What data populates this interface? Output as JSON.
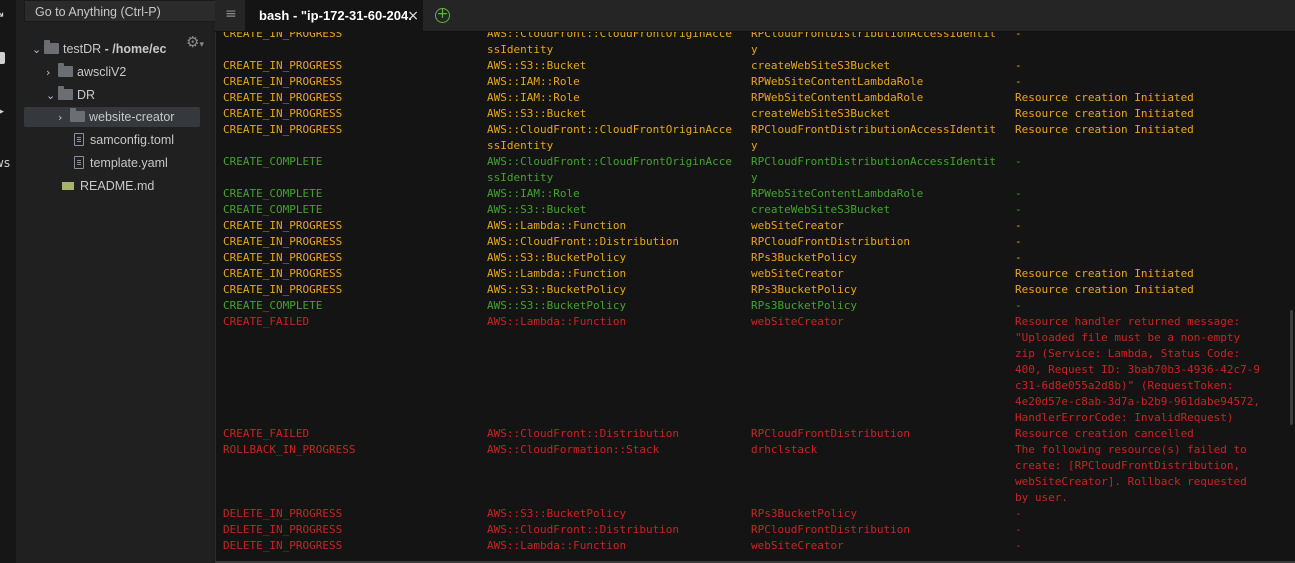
{
  "sidebar": {
    "goto_placeholder": "Go to Anything (Ctrl-P)",
    "tree": [
      {
        "name": "testDR",
        "suffix": " - /home/ec",
        "type": "folder",
        "expanded": true
      },
      {
        "name": "awscliV2",
        "type": "folder",
        "expanded": false
      },
      {
        "name": "DR",
        "type": "folder",
        "expanded": true
      },
      {
        "name": "website-creator",
        "type": "folder",
        "expanded": false,
        "selected": true
      },
      {
        "name": "samconfig.toml",
        "type": "file"
      },
      {
        "name": "template.yaml",
        "type": "file"
      },
      {
        "name": "README.md",
        "type": "markdown"
      }
    ]
  },
  "tabs": {
    "active_title": "bash - \"ip-172-31-60-204.",
    "close_icon": "×"
  },
  "colors": {
    "in_progress": "#e5a61e",
    "complete": "#43a32f",
    "failed": "#c72523",
    "add_tab": "#5fb832"
  },
  "terminal": {
    "rows": [
      {
        "color": "yellow",
        "status": "CREATE_IN_PROGRESS",
        "type": "AWS::CloudFront::CloudFrontOriginAcce\nssIdentity",
        "logical_id": "RPCloudFrontDistributionAccessIdentit\ny",
        "reason": "-"
      },
      {
        "color": "yellow",
        "status": "CREATE_IN_PROGRESS",
        "type": "AWS::S3::Bucket",
        "logical_id": "createWebSiteS3Bucket",
        "reason": "-"
      },
      {
        "color": "yellow",
        "status": "CREATE_IN_PROGRESS",
        "type": "AWS::IAM::Role",
        "logical_id": "RPWebSiteContentLambdaRole",
        "reason": "-"
      },
      {
        "color": "yellow",
        "status": "CREATE_IN_PROGRESS",
        "type": "AWS::IAM::Role",
        "logical_id": "RPWebSiteContentLambdaRole",
        "reason": "Resource creation Initiated"
      },
      {
        "color": "yellow",
        "status": "CREATE_IN_PROGRESS",
        "type": "AWS::S3::Bucket",
        "logical_id": "createWebSiteS3Bucket",
        "reason": "Resource creation Initiated"
      },
      {
        "color": "yellow",
        "status": "CREATE_IN_PROGRESS",
        "type": "AWS::CloudFront::CloudFrontOriginAcce\nssIdentity",
        "logical_id": "RPCloudFrontDistributionAccessIdentit\ny",
        "reason": "Resource creation Initiated"
      },
      {
        "color": "green",
        "status": "CREATE_COMPLETE",
        "type": "AWS::CloudFront::CloudFrontOriginAcce\nssIdentity",
        "logical_id": "RPCloudFrontDistributionAccessIdentit\ny",
        "reason": "-"
      },
      {
        "color": "green",
        "status": "CREATE_COMPLETE",
        "type": "AWS::IAM::Role",
        "logical_id": "RPWebSiteContentLambdaRole",
        "reason": "-"
      },
      {
        "color": "green",
        "status": "CREATE_COMPLETE",
        "type": "AWS::S3::Bucket",
        "logical_id": "createWebSiteS3Bucket",
        "reason": "-"
      },
      {
        "color": "yellow",
        "status": "CREATE_IN_PROGRESS",
        "type": "AWS::Lambda::Function",
        "logical_id": "webSiteCreator",
        "reason": "-"
      },
      {
        "color": "yellow",
        "status": "CREATE_IN_PROGRESS",
        "type": "AWS::CloudFront::Distribution",
        "logical_id": "RPCloudFrontDistribution",
        "reason": "-"
      },
      {
        "color": "yellow",
        "status": "CREATE_IN_PROGRESS",
        "type": "AWS::S3::BucketPolicy",
        "logical_id": "RPs3BucketPolicy",
        "reason": "-"
      },
      {
        "color": "yellow",
        "status": "CREATE_IN_PROGRESS",
        "type": "AWS::Lambda::Function",
        "logical_id": "webSiteCreator",
        "reason": "Resource creation Initiated"
      },
      {
        "color": "yellow",
        "status": "CREATE_IN_PROGRESS",
        "type": "AWS::S3::BucketPolicy",
        "logical_id": "RPs3BucketPolicy",
        "reason": "Resource creation Initiated"
      },
      {
        "color": "green",
        "status": "CREATE_COMPLETE",
        "type": "AWS::S3::BucketPolicy",
        "logical_id": "RPs3BucketPolicy",
        "reason": "-"
      },
      {
        "color": "red",
        "status": "CREATE_FAILED",
        "type": "AWS::Lambda::Function",
        "logical_id": "webSiteCreator",
        "reason": "Resource handler returned message:\n\"Uploaded file must be a non-empty\nzip (Service: Lambda, Status Code:\n400, Request ID: 3bab70b3-4936-42c7-9\nc31-6d8e055a2d8b)\" (RequestToken:\n4e20d57e-c8ab-3d7a-b2b9-961dabe94572,\nHandlerErrorCode: InvalidRequest)"
      },
      {
        "color": "red",
        "status": "CREATE_FAILED",
        "type": "AWS::CloudFront::Distribution",
        "logical_id": "RPCloudFrontDistribution",
        "reason": "Resource creation cancelled"
      },
      {
        "color": "red",
        "status": "ROLLBACK_IN_PROGRESS",
        "type": "AWS::CloudFormation::Stack",
        "logical_id": "drhclstack",
        "reason": "The following resource(s) failed to\ncreate: [RPCloudFrontDistribution,\nwebSiteCreator]. Rollback requested\nby user."
      },
      {
        "color": "red",
        "status": "DELETE_IN_PROGRESS",
        "type": "AWS::S3::BucketPolicy",
        "logical_id": "RPs3BucketPolicy",
        "reason": "-"
      },
      {
        "color": "red",
        "status": "DELETE_IN_PROGRESS",
        "type": "AWS::CloudFront::Distribution",
        "logical_id": "RPCloudFrontDistribution",
        "reason": "-"
      },
      {
        "color": "red",
        "status": "DELETE_IN_PROGRESS",
        "type": "AWS::Lambda::Function",
        "logical_id": "webSiteCreator",
        "reason": "-"
      }
    ]
  }
}
